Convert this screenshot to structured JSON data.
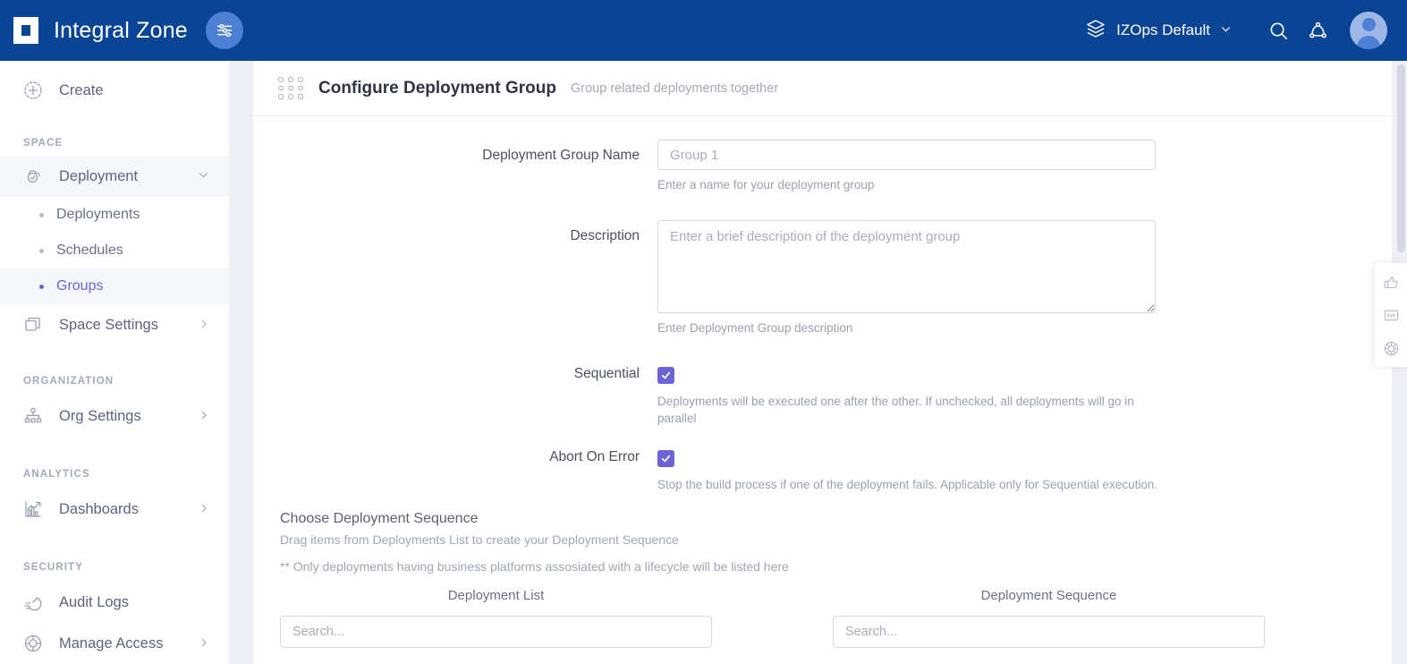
{
  "topbar": {
    "brand_name": "Integral Zone",
    "sliders_icon": "sliders-icon",
    "space_switcher": {
      "layers_icon": "layers-icon",
      "label": "IZOps Default",
      "chevron": "chevron-down-icon"
    },
    "search_icon": "search-icon",
    "share_icon": "share-nodes-icon",
    "avatar": "user-avatar",
    "bg_color": "#0a4595",
    "accent_circle_color": "#4d7fd4"
  },
  "sidebar": {
    "create": {
      "label": "Create",
      "icon": "plus-circle-icon"
    },
    "groups": [
      {
        "title": "SPACE",
        "items": [
          {
            "label": "Deployment",
            "icon": "cloud-check-icon",
            "expanded": true,
            "chevron": "chevron-down-icon",
            "children": [
              {
                "label": "Deployments",
                "selected": false
              },
              {
                "label": "Schedules",
                "selected": false
              },
              {
                "label": "Groups",
                "selected": true
              }
            ]
          },
          {
            "label": "Space Settings",
            "icon": "layers-stack-icon",
            "chevron": "chevron-right-icon"
          }
        ]
      },
      {
        "title": "ORGANIZATION",
        "items": [
          {
            "label": "Org Settings",
            "icon": "org-chart-icon",
            "chevron": "chevron-right-icon"
          }
        ]
      },
      {
        "title": "ANALYTICS",
        "items": [
          {
            "label": "Dashboards",
            "icon": "chart-line-icon",
            "chevron": "chevron-right-icon"
          }
        ]
      },
      {
        "title": "SECURITY",
        "items": [
          {
            "label": "Audit Logs",
            "icon": "audit-stopwatch-icon",
            "chevron": ""
          },
          {
            "label": "Manage Access",
            "icon": "access-shield-icon",
            "chevron": "chevron-right-icon"
          }
        ]
      }
    ],
    "active_item_color": "#6c63d6"
  },
  "page": {
    "icon": "dot-grid-icon",
    "title": "Configure Deployment Group",
    "subtitle": "Group related deployments together"
  },
  "form": {
    "name_field": {
      "label": "Deployment Group Name",
      "value": "",
      "placeholder": "Group 1",
      "hint": "Enter a name for your deployment group"
    },
    "description_field": {
      "label": "Description",
      "value": "",
      "placeholder": "Enter a brief description of the deployment group",
      "hint": "Enter Deployment Group description"
    },
    "sequential": {
      "label": "Sequential",
      "checked": true,
      "hint": "Deployments will be executed one after the other. If unchecked, all deployments will go in parallel"
    },
    "abort_on_error": {
      "label": "Abort On Error",
      "checked": true,
      "hint": "Stop the build process if one of the deployment fails. Applicable only for Sequential execution."
    },
    "checkbox_color": "#6c63d6"
  },
  "sequence_section": {
    "title": "Choose Deployment Sequence",
    "subtitle": "Drag items from Deployments List to create your Deployment Sequence",
    "note": "** Only deployments having business platforms assosiated with a lifecycle will be listed here",
    "columns": [
      {
        "heading": "Deployment List",
        "search_placeholder": "Search...",
        "search_value": ""
      },
      {
        "heading": "Deployment Sequence",
        "search_placeholder": "Search...",
        "search_value": ""
      }
    ]
  },
  "float_widget": {
    "buttons": [
      {
        "icon": "thumbs-up-icon"
      },
      {
        "icon": "code-embed-icon"
      },
      {
        "icon": "target-circle-icon"
      }
    ]
  }
}
